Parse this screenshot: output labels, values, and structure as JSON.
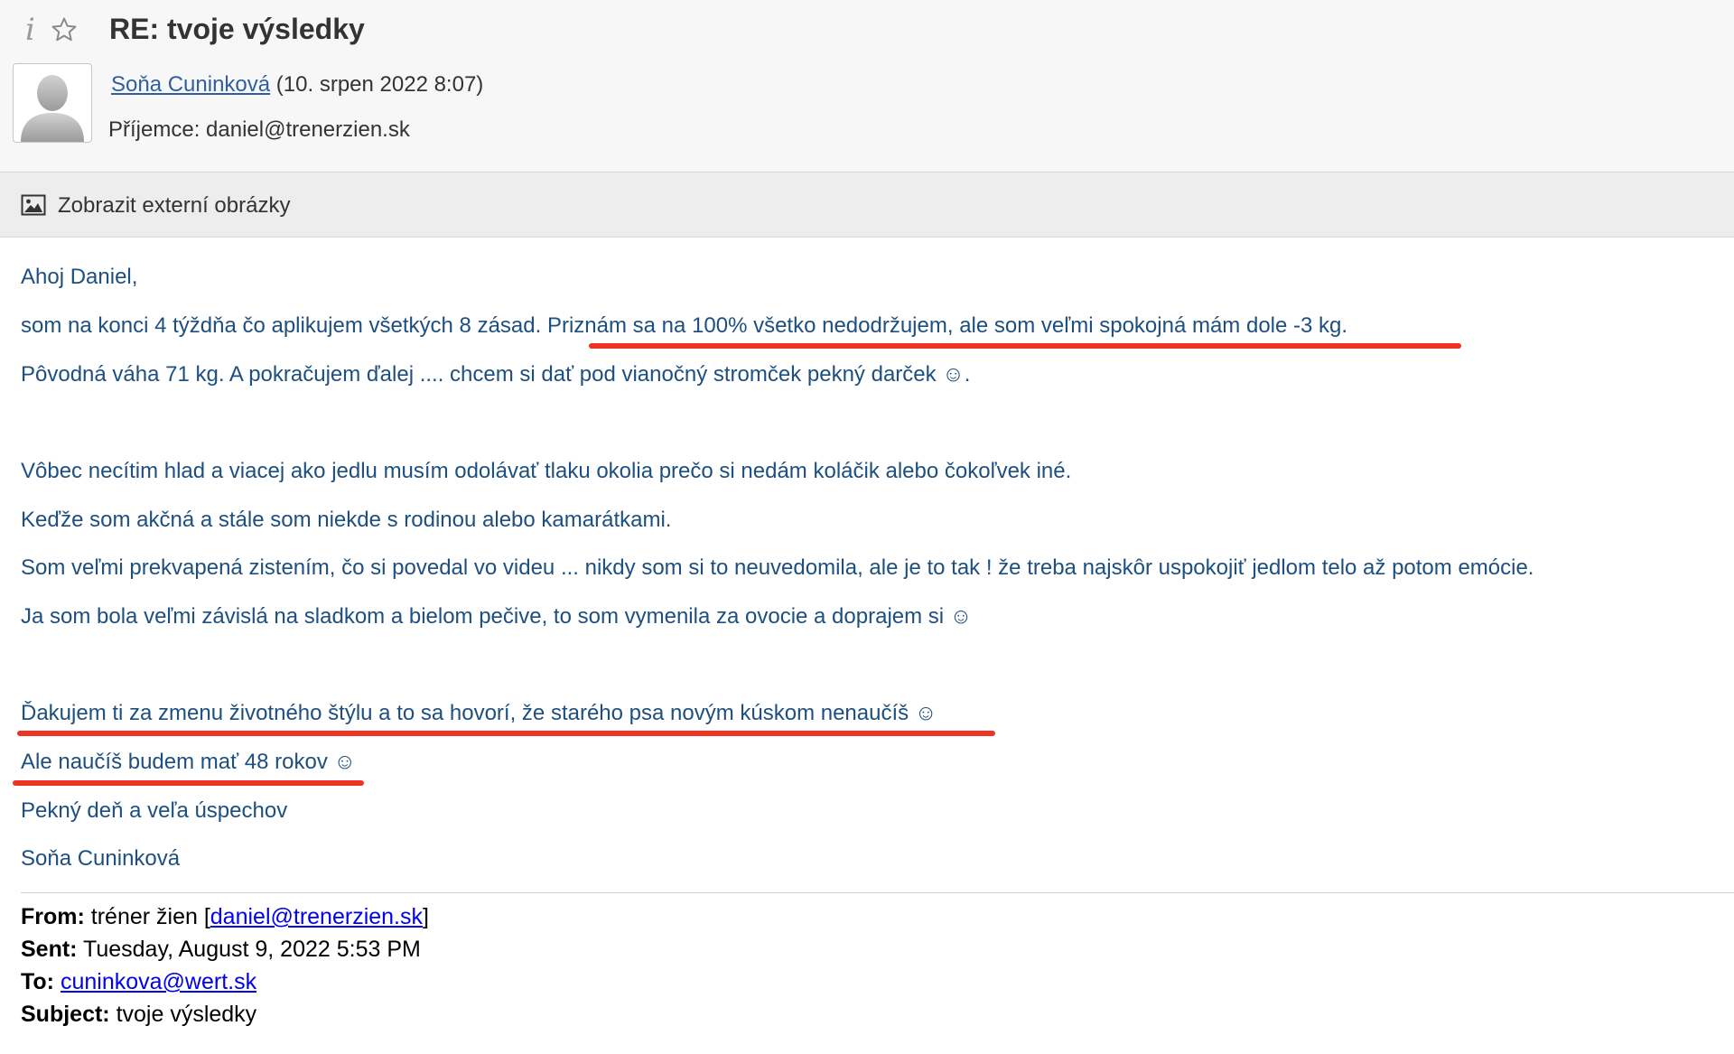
{
  "header": {
    "info_glyph": "i",
    "subject": "RE: tvoje výsledky",
    "sender_name": "Soňa Cuninková",
    "sent_date": "(10. srpen 2022 8:07)",
    "recipient_label": "Příjemce:",
    "recipient_email": "daniel@trenerzien.sk"
  },
  "external_images": {
    "label": "Zobrazit externí obrázky"
  },
  "body": {
    "greeting": "Ahoj Daniel,",
    "line1_start": "som na konci 4 týždňa čo aplikujem všetkých 8 zásad. ",
    "line1_highlight": "Priznám sa na 100% všetko nedodržujem, ale som veľmi spokojná mám dole -3 kg.",
    "line2": "Pôvodná váha 71 kg. A pokračujem ďalej .... chcem si dať pod vianočný stromček pekný darček ☺.",
    "line3": "Vôbec necítim hlad a viacej ako jedlu musím odolávať tlaku okolia prečo si nedám koláčik alebo čokoľvek iné.",
    "line4": "Keďže som akčná a stále som niekde s rodinou alebo kamarátkami.",
    "line5": "Som veľmi prekvapená zistením, čo si povedal vo videu ... nikdy som si to neuvedomila, ale je to tak ! že treba najskôr uspokojiť jedlom telo až potom emócie.",
    "line6": "Ja som bola veľmi závislá na sladkom a bielom pečive, to som vymenila za ovocie a doprajem si ☺",
    "line7": "Ďakujem ti za zmenu životného štýlu a to sa hovorí, že starého psa novým kúskom nenaučíš ☺",
    "line8": "Ale naučíš budem mať 48 rokov ☺",
    "line9": "Pekný deň a veľa úspechov",
    "signature": "Soňa Cuninková"
  },
  "quoted": {
    "from_label": "From:",
    "from_name": " tréner žien [",
    "from_email": "daniel@trenerzien.sk",
    "from_close": "]",
    "sent_label": "Sent:",
    "sent_value": " Tuesday, August 9, 2022 5:53 PM",
    "to_label": "To:",
    "to_email": "cuninkova@wert.sk",
    "subject_label": "Subject:",
    "subject_value": " tvoje výsledky"
  },
  "colors": {
    "body_text": "#1d4f80",
    "highlight_underline": "#ee3322",
    "link": "#0000ee"
  },
  "icons": [
    "info-icon",
    "star-icon",
    "avatar-placeholder-icon",
    "image-icon"
  ]
}
